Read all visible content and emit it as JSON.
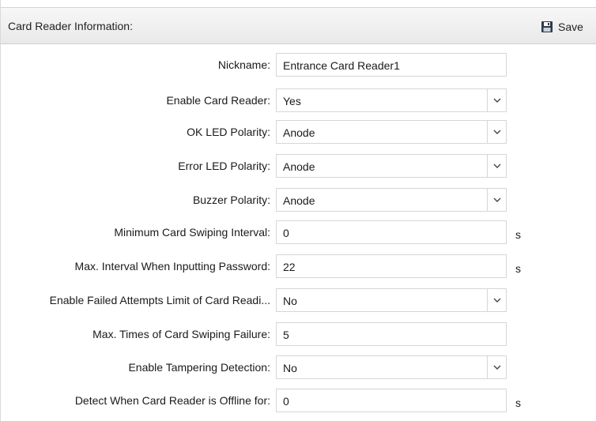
{
  "header": {
    "title": "Card Reader Information:",
    "save_label": "Save",
    "save_icon": "save-disk-icon"
  },
  "fields": [
    {
      "label": "Nickname:",
      "value": "Entrance Card Reader1",
      "type": "text"
    },
    {
      "label": "Enable Card Reader:",
      "value": "Yes",
      "type": "select"
    },
    {
      "label": "OK LED Polarity:",
      "value": "Anode",
      "type": "select"
    },
    {
      "label": "Error LED Polarity:",
      "value": "Anode",
      "type": "select"
    },
    {
      "label": "Buzzer Polarity:",
      "value": "Anode",
      "type": "select"
    },
    {
      "label": "Minimum Card Swiping Interval:",
      "value": "0",
      "type": "text",
      "unit": "s"
    },
    {
      "label": "Max. Interval When Inputting Password:",
      "value": "22",
      "type": "text",
      "unit": "s"
    },
    {
      "label": "Enable Failed Attempts Limit of Card Readi...",
      "value": "No",
      "type": "select"
    },
    {
      "label": "Max. Times of Card Swiping Failure:",
      "value": "5",
      "type": "text"
    },
    {
      "label": "Enable Tampering Detection:",
      "value": "No",
      "type": "select"
    },
    {
      "label": "Detect When Card Reader is Offline for:",
      "value": "0",
      "type": "text",
      "unit": "s"
    }
  ],
  "colors": {
    "header_bg": "#ececec",
    "border": "#d6d6d6",
    "text": "#1a1a1a"
  }
}
